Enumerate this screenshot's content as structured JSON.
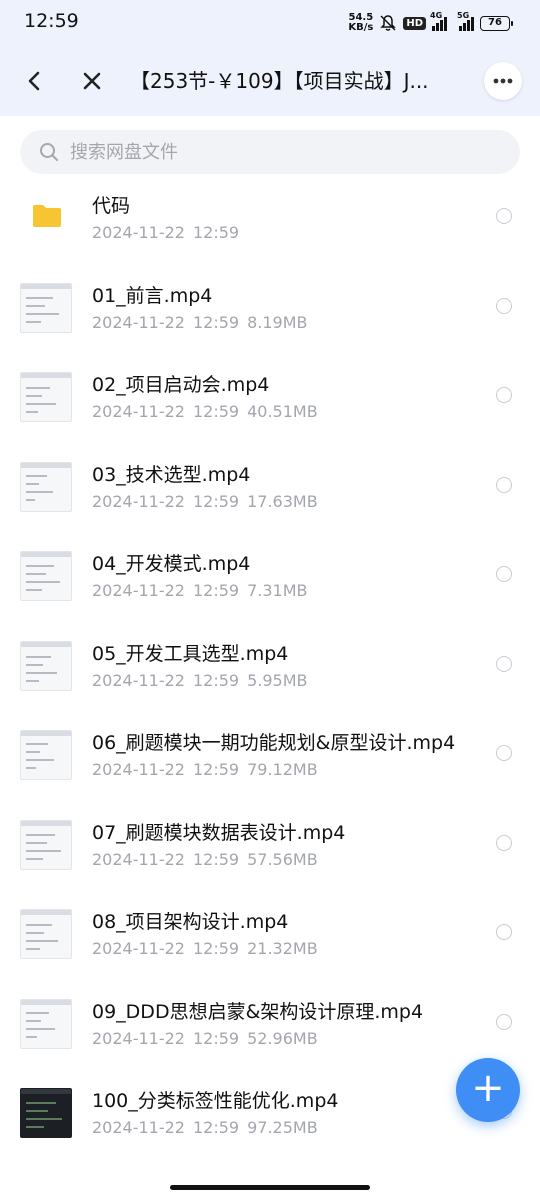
{
  "status_bar": {
    "time": "12:59",
    "net_speed_value": "54.5",
    "net_speed_unit": "KB/s",
    "hd_badge": "HD",
    "sig1_label": "4G",
    "sig2_label": "5G",
    "battery": "76"
  },
  "header": {
    "back_icon": "back-arrow-icon",
    "close_icon": "close-icon",
    "title": "【253节-￥109】【项目实战】J...",
    "more_icon": "more-icon"
  },
  "search": {
    "placeholder": "搜索网盘文件",
    "value": ""
  },
  "files": [
    {
      "name": "代码",
      "date": "2024-11-22",
      "time": "12:59",
      "size": "",
      "type": "folder"
    },
    {
      "name": "01_前言.mp4",
      "date": "2024-11-22",
      "time": "12:59",
      "size": "8.19MB",
      "type": "video"
    },
    {
      "name": "02_项目启动会.mp4",
      "date": "2024-11-22",
      "time": "12:59",
      "size": "40.51MB",
      "type": "video"
    },
    {
      "name": "03_技术选型.mp4",
      "date": "2024-11-22",
      "time": "12:59",
      "size": "17.63MB",
      "type": "video"
    },
    {
      "name": "04_开发模式.mp4",
      "date": "2024-11-22",
      "time": "12:59",
      "size": "7.31MB",
      "type": "video"
    },
    {
      "name": "05_开发工具选型.mp4",
      "date": "2024-11-22",
      "time": "12:59",
      "size": "5.95MB",
      "type": "video"
    },
    {
      "name": "06_刷题模块一期功能规划&原型设计.mp4",
      "date": "2024-11-22",
      "time": "12:59",
      "size": "79.12MB",
      "type": "video"
    },
    {
      "name": "07_刷题模块数据表设计.mp4",
      "date": "2024-11-22",
      "time": "12:59",
      "size": "57.56MB",
      "type": "video"
    },
    {
      "name": "08_项目架构设计.mp4",
      "date": "2024-11-22",
      "time": "12:59",
      "size": "21.32MB",
      "type": "video"
    },
    {
      "name": "09_DDD思想启蒙&架构设计原理.mp4",
      "date": "2024-11-22",
      "time": "12:59",
      "size": "52.96MB",
      "type": "video"
    },
    {
      "name": "100_分类标签性能优化.mp4",
      "date": "2024-11-22",
      "time": "12:59",
      "size": "97.25MB",
      "type": "video"
    }
  ],
  "fab": {
    "label": "+"
  },
  "colors": {
    "header_bg": "#eef2fc",
    "accent": "#3f8ef6",
    "meta_text": "#a3a6ad",
    "folder": "#f7c531"
  }
}
